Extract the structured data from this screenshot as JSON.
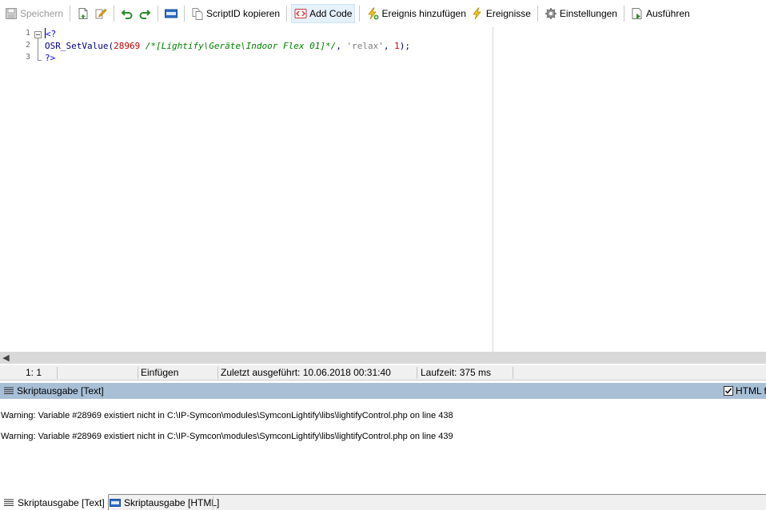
{
  "toolbar": {
    "save_label": "Speichern",
    "scriptid_label": "ScriptID kopieren",
    "addcode_label": "Add Code",
    "add_event_label": "Ereignis hinzufügen",
    "events_label": "Ereignisse",
    "settings_label": "Einstellungen",
    "run_label": "Ausführen"
  },
  "editor": {
    "line_numbers": [
      "1",
      "2",
      "3"
    ],
    "lines": {
      "l1_open": "<?",
      "l2_fn": "OSR_SetValue(",
      "l2_num": "28969",
      "l2_space": " ",
      "l2_comment": "/*[Lightify\\Geräte\\Indoor Flex 01]*/",
      "l2_sep1": ", ",
      "l2_str": "'relax'",
      "l2_sep2": ", ",
      "l2_num2": "1",
      "l2_end": ");",
      "l3_close": "?>"
    }
  },
  "status": {
    "position": "1:  1",
    "mode": "Einfügen",
    "last_run": "Zuletzt ausgeführt: 10.06.2018 00:31:40",
    "runtime": "Laufzeit: 375 ms"
  },
  "output_panel": {
    "title": "Skriptausgabe [Text]",
    "html_filter_label": "HTML fil",
    "lines": [
      "Warning:  Variable #28969 existiert nicht in C:\\IP-Symcon\\modules\\SymconLightify\\libs\\lightifyControl.php on line 438",
      "Warning:  Variable #28969 existiert nicht in C:\\IP-Symcon\\modules\\SymconLightify\\libs\\lightifyControl.php on line 439"
    ]
  },
  "tabs": [
    {
      "label": "Skriptausgabe [Text]"
    },
    {
      "label": "Skriptausgabe [HTML]"
    }
  ]
}
